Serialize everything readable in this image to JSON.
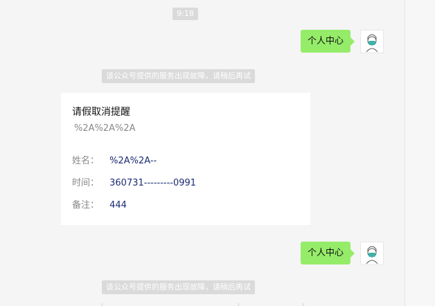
{
  "time": "9:18",
  "messages": [
    {
      "text": "个人中心"
    },
    {
      "text": "个人中心"
    }
  ],
  "system_notices": [
    "该公众号提供的服务出现故障，请稍后再试",
    "该公众号提供的服务出现故障，请稍后再试"
  ],
  "card": {
    "title": "请假取消提醒",
    "subtitle": "%2A%2A%2A",
    "fields": [
      {
        "label": "姓名：",
        "value": "%2A%2A--"
      },
      {
        "label": "时间：",
        "value": "360731---------0991"
      },
      {
        "label": "备注：",
        "value": "444"
      }
    ]
  },
  "colors": {
    "bubble": "#95ec69",
    "value_text": "#1b2a72",
    "notice_bg": "#dadada",
    "background": "#f5f5f5"
  }
}
